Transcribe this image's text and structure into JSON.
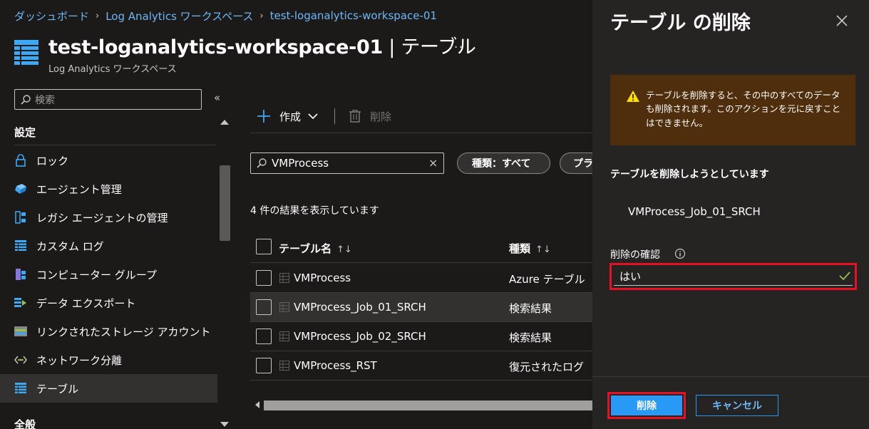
{
  "breadcrumb": [
    "ダッシュボード",
    "Log Analytics ワークスペース",
    "test-loganalytics-workspace-01"
  ],
  "header": {
    "title": "test-loganalytics-workspace-01",
    "title_suffix": " | テーブル",
    "more": "···",
    "subtitle": "Log Analytics ワークスペース"
  },
  "sidebar": {
    "search_placeholder": "検索",
    "collapse": "«",
    "section": "設定",
    "items": [
      {
        "label": "ロック",
        "icon": "lock-icon"
      },
      {
        "label": "エージェント管理",
        "icon": "agent-icon"
      },
      {
        "label": "レガシ エージェントの管理",
        "icon": "legacy-agent-icon"
      },
      {
        "label": "カスタム ログ",
        "icon": "custom-log-icon"
      },
      {
        "label": "コンピューター グループ",
        "icon": "computer-group-icon"
      },
      {
        "label": "データ エクスポート",
        "icon": "data-export-icon"
      },
      {
        "label": "リンクされたストレージ アカウント",
        "icon": "storage-icon"
      },
      {
        "label": "ネットワーク分離",
        "icon": "network-icon"
      },
      {
        "label": "テーブル",
        "icon": "table-icon",
        "selected": true
      }
    ],
    "section2": "全般"
  },
  "toolbar": {
    "create": "作成",
    "delete": "削除"
  },
  "filter": {
    "value": "VMProcess",
    "clear": "×",
    "pill_type": "種類：すべて",
    "pill_plan": "プラン"
  },
  "results": {
    "count_text": "4 件の結果を表示しています"
  },
  "table": {
    "columns": [
      {
        "label": "テーブル名",
        "sort": "↑↓"
      },
      {
        "label": "種類",
        "sort": "↑↓"
      }
    ],
    "rows": [
      {
        "name": "VMProcess",
        "type": "Azure テーブル"
      },
      {
        "name": "VMProcess_Job_01_SRCH",
        "type": "検索結果",
        "highlighted": true
      },
      {
        "name": "VMProcess_Job_02_SRCH",
        "type": "検索結果"
      },
      {
        "name": "VMProcess_RST",
        "type": "復元されたログ"
      }
    ]
  },
  "panel": {
    "title": "テーブル の削除",
    "warning": "テーブルを削除すると、その中のすべてのデータも削除されます。このアクションを元に戻すことはできません。",
    "about_to_delete": "テーブルを削除しようとしています",
    "table_name": "VMProcess_Job_01_SRCH",
    "confirm_label": "削除の確認",
    "confirm_value": "はい",
    "delete_button": "削除",
    "cancel_button": "キャンセル"
  },
  "colors": {
    "accent": "#2899f5",
    "link": "#6cb8f6",
    "highlight": "#e81123",
    "warning_bg": "#4f2e0d",
    "warning_icon": "#fce100",
    "success": "#92c353"
  }
}
